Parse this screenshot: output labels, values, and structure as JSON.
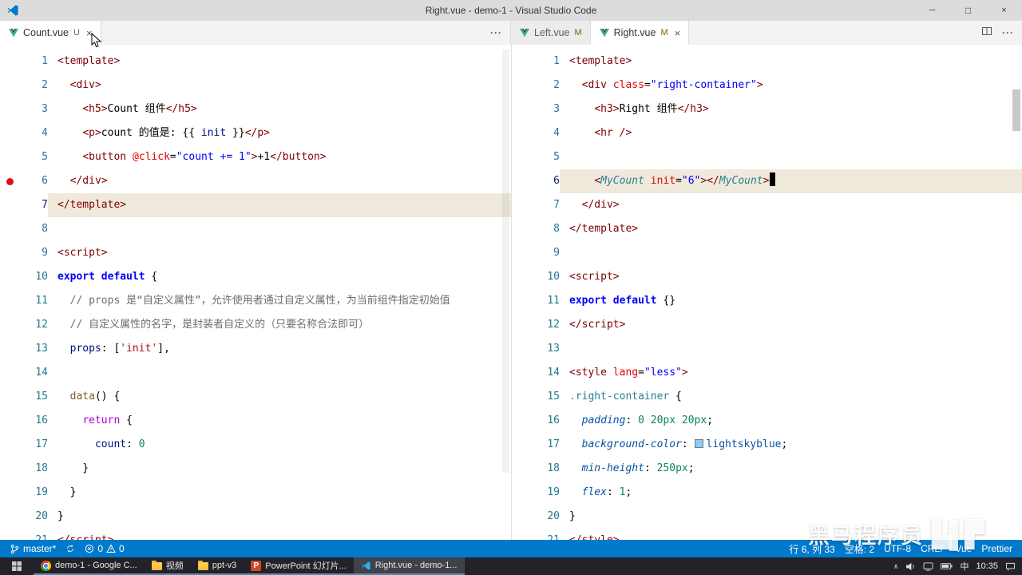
{
  "window": {
    "title": "Right.vue - demo-1 - Visual Studio Code"
  },
  "tabs": {
    "left_group": {
      "name": "Count.vue",
      "badge": "U"
    },
    "right_group": [
      {
        "name": "Left.vue",
        "badge": "M"
      },
      {
        "name": "Right.vue",
        "badge": "M"
      }
    ]
  },
  "editors": {
    "left": {
      "active_line": 7,
      "breakpoint_line": 6,
      "lines": [
        [
          [
            "t",
            "<template>"
          ]
        ],
        [
          [
            "d",
            "  "
          ],
          [
            "t",
            "<div>"
          ]
        ],
        [
          [
            "d",
            "    "
          ],
          [
            "t",
            "<h5>"
          ],
          [
            "d",
            "Count 组件"
          ],
          [
            "t",
            "</h5>"
          ]
        ],
        [
          [
            "d",
            "    "
          ],
          [
            "t",
            "<p>"
          ],
          [
            "d",
            "count 的值是: "
          ],
          [
            "d",
            "{{ "
          ],
          [
            "ok",
            "init"
          ],
          [
            "d",
            " }}"
          ],
          [
            "t",
            "</p>"
          ]
        ],
        [
          [
            "d",
            "    "
          ],
          [
            "t",
            "<button "
          ],
          [
            "a",
            "@click"
          ],
          [
            "d",
            "="
          ],
          [
            "v",
            "\"count += 1\""
          ],
          [
            "t",
            ">"
          ],
          [
            "d",
            "+1"
          ],
          [
            "t",
            "</button>"
          ]
        ],
        [
          [
            "d",
            "  "
          ],
          [
            "t",
            "</div>"
          ]
        ],
        [
          [
            "t",
            "</template>"
          ]
        ],
        [],
        [
          [
            "t",
            "<script>"
          ]
        ],
        [
          [
            "k",
            "export default"
          ],
          [
            "d",
            " {"
          ]
        ],
        [
          [
            "c",
            "  // props 是“自定义属性”，允许使用者通过自定义属性，为当前组件指定初始值"
          ]
        ],
        [
          [
            "c",
            "  // 自定义属性的名字，是封装者自定义的（只要名称合法即可）"
          ]
        ],
        [
          [
            "d",
            "  "
          ],
          [
            "ok",
            "props"
          ],
          [
            "d",
            ": ["
          ],
          [
            "s",
            "'init'"
          ],
          [
            "d",
            "],"
          ]
        ],
        [],
        [
          [
            "d",
            "  "
          ],
          [
            "f",
            "data"
          ],
          [
            "d",
            "() {"
          ]
        ],
        [
          [
            "d",
            "    "
          ],
          [
            "r",
            "return"
          ],
          [
            "d",
            " {"
          ]
        ],
        [
          [
            "d",
            "      "
          ],
          [
            "ok",
            "count"
          ],
          [
            "d",
            ": "
          ],
          [
            "n",
            "0"
          ]
        ],
        [
          [
            "d",
            "    }"
          ]
        ],
        [
          [
            "d",
            "  }"
          ]
        ],
        [
          [
            "d",
            "}"
          ]
        ],
        [
          [
            "t",
            "</script>"
          ]
        ]
      ]
    },
    "right": {
      "active_line": 6,
      "cursor_line": 6,
      "lines": [
        [
          [
            "t",
            "<template>"
          ]
        ],
        [
          [
            "d",
            "  "
          ],
          [
            "t",
            "<div "
          ],
          [
            "a",
            "class"
          ],
          [
            "d",
            "="
          ],
          [
            "v",
            "\"right-container\""
          ],
          [
            "t",
            ">"
          ]
        ],
        [
          [
            "d",
            "    "
          ],
          [
            "t",
            "<h3>"
          ],
          [
            "d",
            "Right 组件"
          ],
          [
            "t",
            "</h3>"
          ]
        ],
        [
          [
            "d",
            "    "
          ],
          [
            "t",
            "<hr />"
          ]
        ],
        [],
        [
          [
            "d",
            "    "
          ],
          [
            "t",
            "<"
          ],
          [
            "m",
            "MyCount"
          ],
          [
            "d",
            " "
          ],
          [
            "a",
            "init"
          ],
          [
            "d",
            "="
          ],
          [
            "v",
            "\"6\""
          ],
          [
            "t",
            ">"
          ],
          [
            "t",
            "</"
          ],
          [
            "m",
            "MyCount"
          ],
          [
            "t",
            ">"
          ]
        ],
        [
          [
            "d",
            "  "
          ],
          [
            "t",
            "</div>"
          ]
        ],
        [
          [
            "t",
            "</template>"
          ]
        ],
        [],
        [
          [
            "t",
            "<script>"
          ]
        ],
        [
          [
            "k",
            "export default"
          ],
          [
            "d",
            " {}"
          ]
        ],
        [
          [
            "t",
            "</script>"
          ]
        ],
        [],
        [
          [
            "t",
            "<style "
          ],
          [
            "a",
            "lang"
          ],
          [
            "d",
            "="
          ],
          [
            "v",
            "\"less\""
          ],
          [
            "t",
            ">"
          ]
        ],
        [
          [
            "sel",
            ".right-container"
          ],
          [
            "d",
            " {"
          ]
        ],
        [
          [
            "d",
            "  "
          ],
          [
            "p",
            "padding"
          ],
          [
            "d",
            ": "
          ],
          [
            "n",
            "0 20px 20px"
          ],
          [
            "d",
            ";"
          ]
        ],
        [
          [
            "d",
            "  "
          ],
          [
            "p",
            "background-color"
          ],
          [
            "d",
            ": "
          ],
          [
            "sw",
            "lightskyblue"
          ],
          [
            "w",
            "lightskyblue"
          ],
          [
            "d",
            ";"
          ]
        ],
        [
          [
            "d",
            "  "
          ],
          [
            "p",
            "min-height"
          ],
          [
            "d",
            ": "
          ],
          [
            "n",
            "250px"
          ],
          [
            "d",
            ";"
          ]
        ],
        [
          [
            "d",
            "  "
          ],
          [
            "p",
            "flex"
          ],
          [
            "d",
            ": "
          ],
          [
            "n",
            "1"
          ],
          [
            "d",
            ";"
          ]
        ],
        [
          [
            "d",
            "}"
          ]
        ],
        [
          [
            "t",
            "</style>"
          ]
        ]
      ]
    }
  },
  "status_bar": {
    "branch": "master*",
    "errors": "0",
    "warnings": "0",
    "line_col": "行 6, 列 33",
    "spaces": "空格: 2",
    "encoding": "UTF-8",
    "eol": "CRLF",
    "language": "Vue",
    "formatter": "Prettier"
  },
  "taskbar": {
    "items": [
      {
        "icon": "chrome",
        "label": "demo-1 - Google C...",
        "active": false
      },
      {
        "icon": "folder",
        "label": "视频",
        "active": false
      },
      {
        "icon": "folder",
        "label": "ppt-v3",
        "active": false
      },
      {
        "icon": "powerpoint",
        "label": "PowerPoint 幻灯片...",
        "active": false
      },
      {
        "icon": "vscode",
        "label": "Right.vue - demo-1...",
        "active": true
      }
    ],
    "tray": {
      "ime": "中",
      "time": "10:35"
    }
  },
  "watermark": {
    "text": "黑马程序员",
    "logo": "▙▌▛"
  }
}
